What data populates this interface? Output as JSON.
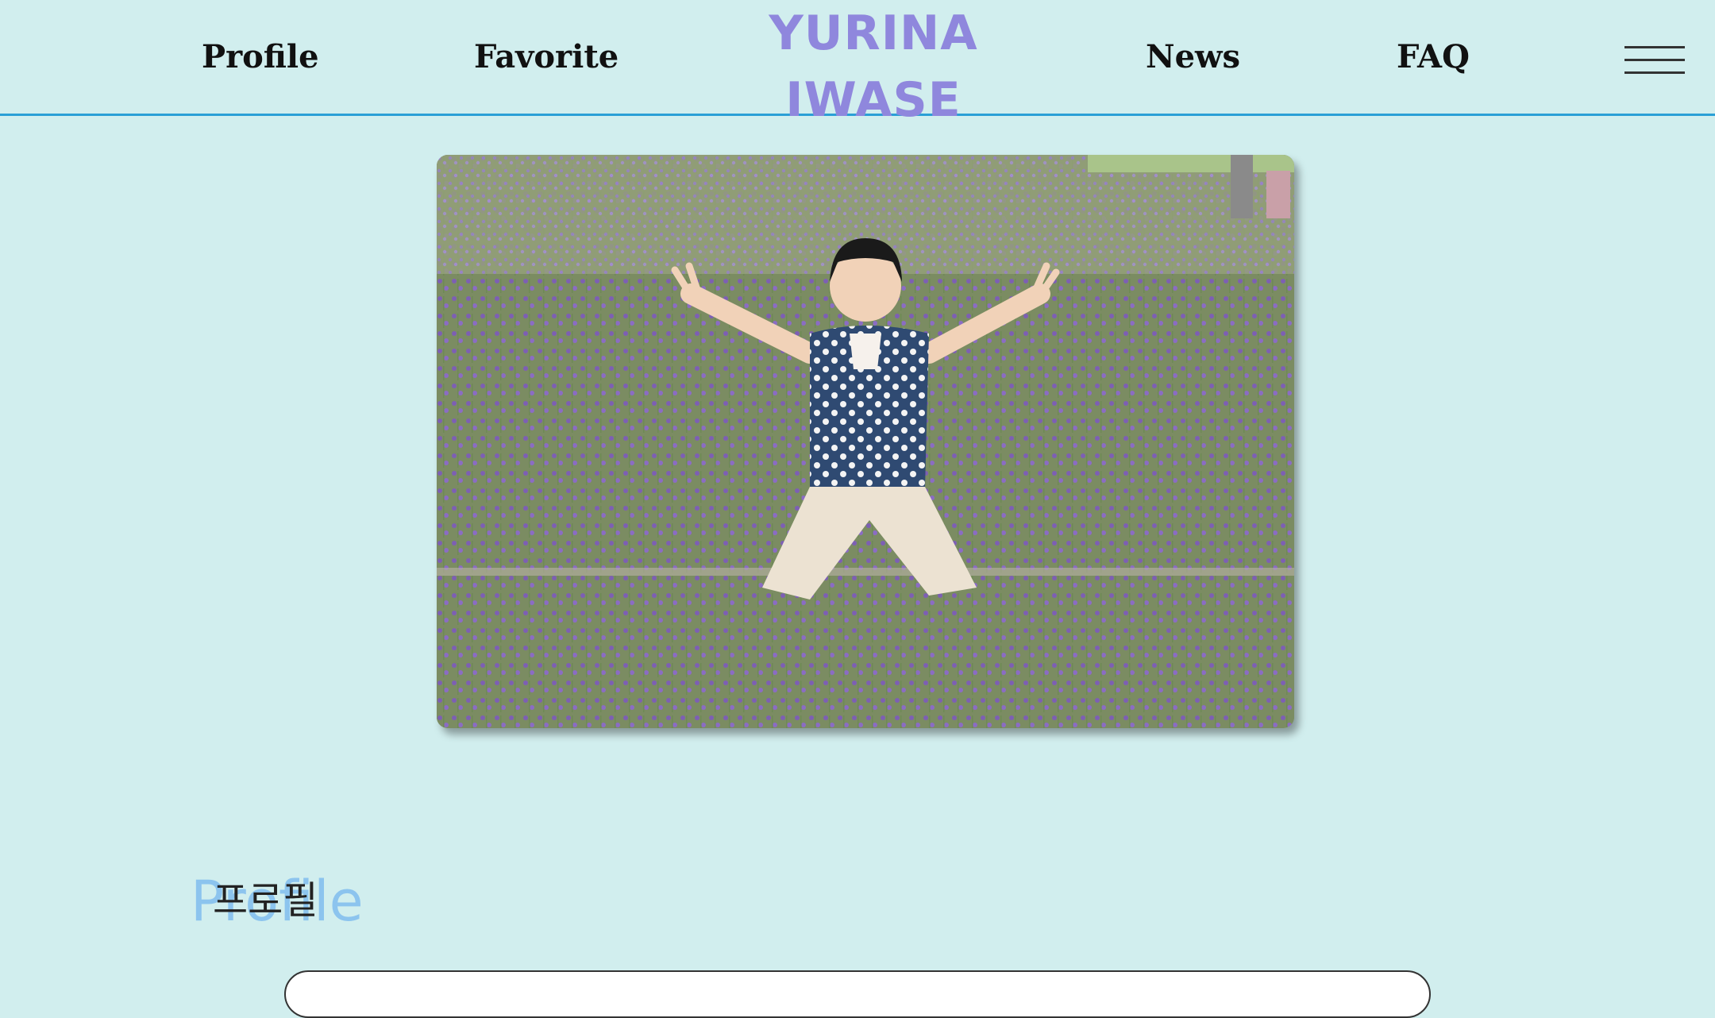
{
  "nav": {
    "profile": "Profile",
    "favorite": "Favorite",
    "news": "News",
    "faq": "FAQ"
  },
  "site_title": {
    "line1": "YURINA",
    "line2": "IWASE"
  },
  "hero": {
    "image": "girl-in-lavender-field-photo"
  },
  "section": {
    "heading_en": "Profile",
    "heading_ko": "프로필"
  },
  "colors": {
    "background": "#d1eeee",
    "title": "#8f87dd",
    "header_rule": "#2a9fd6",
    "heading_accent": "#8cc4ee"
  }
}
